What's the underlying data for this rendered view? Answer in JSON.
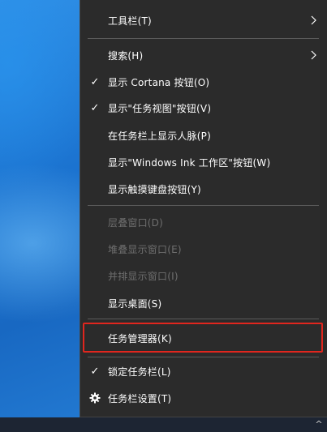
{
  "menu": {
    "items": [
      {
        "label": "工具栏(T)",
        "submenu": true,
        "checked": false,
        "enabled": true
      },
      {
        "label": "搜索(H)",
        "submenu": true,
        "checked": false,
        "enabled": true
      },
      {
        "label": "显示 Cortana 按钮(O)",
        "submenu": false,
        "checked": true,
        "enabled": true
      },
      {
        "label": "显示\"任务视图\"按钮(V)",
        "submenu": false,
        "checked": true,
        "enabled": true
      },
      {
        "label": "在任务栏上显示人脉(P)",
        "submenu": false,
        "checked": false,
        "enabled": true
      },
      {
        "label": "显示\"Windows Ink 工作区\"按钮(W)",
        "submenu": false,
        "checked": false,
        "enabled": true
      },
      {
        "label": "显示触摸键盘按钮(Y)",
        "submenu": false,
        "checked": false,
        "enabled": true
      },
      {
        "label": "层叠窗口(D)",
        "submenu": false,
        "checked": false,
        "enabled": false
      },
      {
        "label": "堆叠显示窗口(E)",
        "submenu": false,
        "checked": false,
        "enabled": false
      },
      {
        "label": "并排显示窗口(I)",
        "submenu": false,
        "checked": false,
        "enabled": false
      },
      {
        "label": "显示桌面(S)",
        "submenu": false,
        "checked": false,
        "enabled": true
      },
      {
        "label": "任务管理器(K)",
        "submenu": false,
        "checked": false,
        "enabled": true,
        "highlighted": true
      },
      {
        "label": "锁定任务栏(L)",
        "submenu": false,
        "checked": true,
        "enabled": true
      },
      {
        "label": "任务栏设置(T)",
        "submenu": false,
        "checked": false,
        "enabled": true,
        "icon": "gear-icon"
      }
    ],
    "check_glyph": "✓"
  },
  "colors": {
    "menu_bg": "#2b2b2b",
    "text": "#ffffff",
    "disabled_text": "#6e6e6e",
    "separator": "#5a5a5a",
    "highlight_border": "#e0261e"
  }
}
